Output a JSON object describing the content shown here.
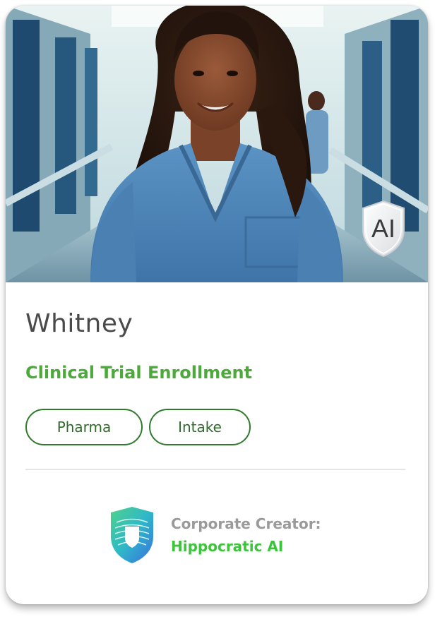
{
  "card": {
    "name": "Whitney",
    "role": "Clinical Trial Enrollment",
    "tags": [
      "Pharma",
      "Intake"
    ],
    "badge_text": "AI",
    "photo_icon": "nurse-portrait-photo",
    "creator": {
      "label": "Corporate Creator:",
      "name": "Hippocratic AI",
      "logo_icon": "hippocratic-ai-shield-logo-icon"
    }
  },
  "colors": {
    "role_green": "#4caa3a",
    "tag_border": "#2f7a2c",
    "creator_green": "#3cc43a",
    "name_gray": "#4a4a4a",
    "label_gray": "#9a9a9a",
    "scrubs_blue": "#4f86b8"
  }
}
